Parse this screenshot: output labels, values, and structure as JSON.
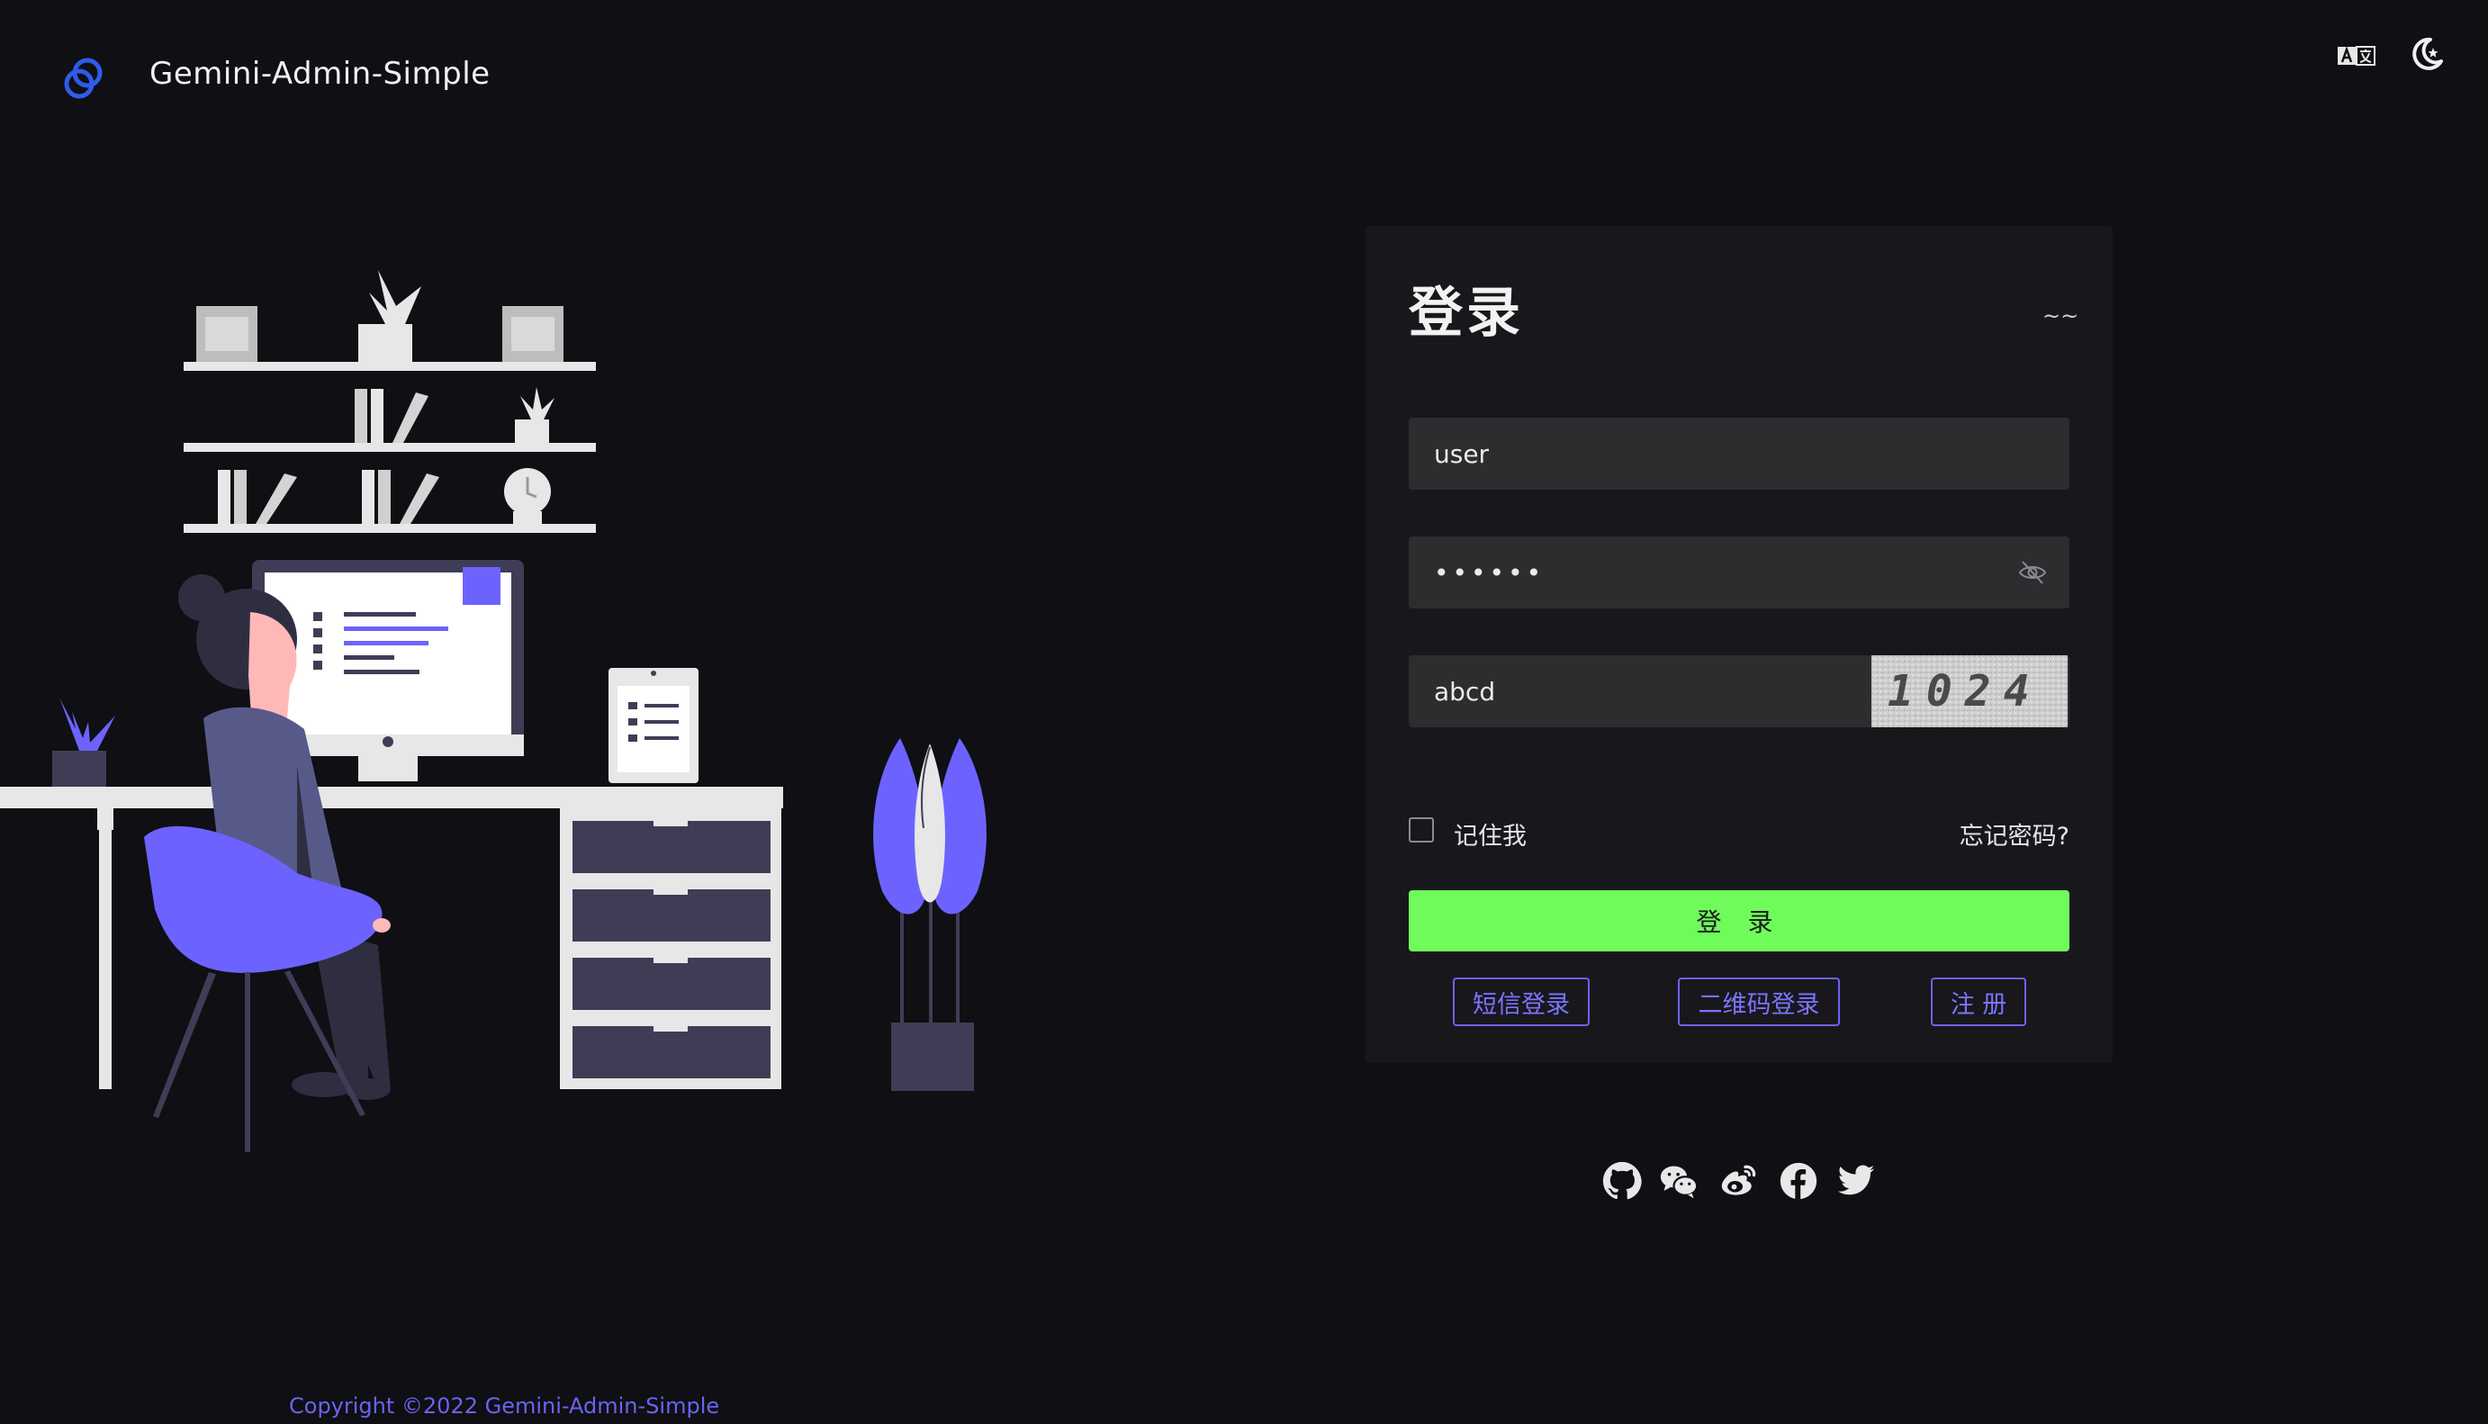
{
  "header": {
    "app_title": "Gemini-Admin-Simple",
    "logo_icon": "gemini-logo-icon",
    "language_icon": "translate-icon",
    "theme_icon": "moon-icon"
  },
  "login": {
    "title": "登录",
    "tilde": "~~",
    "username_value": "user",
    "password_value": "••••••",
    "captcha_value": "abcd",
    "captcha_text": "1024",
    "remember_label": "记住我",
    "forgot_label": "忘记密码?",
    "login_label": "登 录",
    "sms_login_label": "短信登录",
    "qr_login_label": "二维码登录",
    "register_label": "注 册"
  },
  "social": [
    "github-icon",
    "wechat-icon",
    "weibo-icon",
    "facebook-icon",
    "twitter-icon"
  ],
  "footer": {
    "copyright": "Copyright ©2022 Gemini-Admin-Simple"
  },
  "colors": {
    "background": "#0f0f14",
    "card": "#18181c",
    "input": "#2d2d30",
    "primary_button": "#6ffc5b",
    "accent": "#6b63f2",
    "illustration_purple": "#6c63ff"
  }
}
